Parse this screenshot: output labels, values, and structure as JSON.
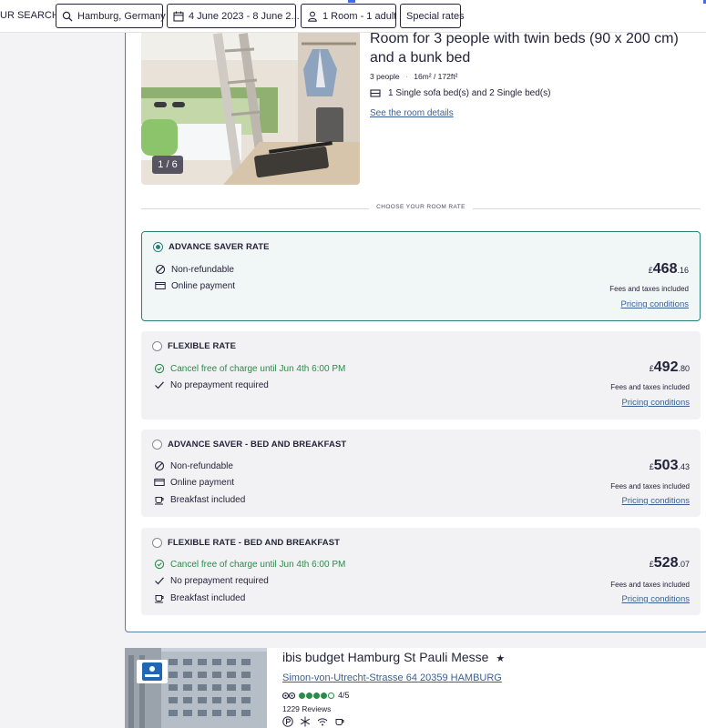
{
  "search": {
    "label": "UR SEARCH",
    "destination": "Hamburg, Germany",
    "dates": "4 June 2023 - 8 June 2...",
    "rooms": "1 Room - 1 adult",
    "special": "Special rates"
  },
  "room": {
    "photo_counter": "1 / 6",
    "title": "Room for 3 people with twin beds (90 x 200 cm) and a bunk bed",
    "people": "3 people",
    "separator": "·",
    "size": "16m² / 172ft²",
    "beds": "1 Single sofa bed(s) and 2 Single bed(s)",
    "details_link": "See the room details"
  },
  "choose_label": "CHOOSE YOUR ROOM RATE",
  "rates": [
    {
      "name": "ADVANCE SAVER RATE",
      "selected": true,
      "features": [
        {
          "icon": "no-entry-icon",
          "text": "Non-refundable",
          "green": false
        },
        {
          "icon": "credit-card-icon",
          "text": "Online payment",
          "green": false
        }
      ],
      "currency": "£",
      "price_int": "468",
      "price_dec": ".16",
      "fees": "Fees and taxes included",
      "conditions": "Pricing conditions"
    },
    {
      "name": "FLEXIBLE RATE",
      "selected": false,
      "features": [
        {
          "icon": "check-circle-icon",
          "text": "Cancel free of charge until Jun 4th 6:00 PM",
          "green": true
        },
        {
          "icon": "checkmark-icon",
          "text": "No prepayment required",
          "green": false
        }
      ],
      "currency": "£",
      "price_int": "492",
      "price_dec": ".80",
      "fees": "Fees and taxes included",
      "conditions": "Pricing conditions"
    },
    {
      "name": "ADVANCE SAVER - BED AND BREAKFAST",
      "selected": false,
      "features": [
        {
          "icon": "no-entry-icon",
          "text": "Non-refundable",
          "green": false
        },
        {
          "icon": "credit-card-icon",
          "text": "Online payment",
          "green": false
        },
        {
          "icon": "coffee-cup-icon",
          "text": "Breakfast included",
          "green": false
        }
      ],
      "currency": "£",
      "price_int": "503",
      "price_dec": ".43",
      "fees": "Fees and taxes included",
      "conditions": "Pricing conditions"
    },
    {
      "name": "FLEXIBLE RATE - BED AND BREAKFAST",
      "selected": false,
      "features": [
        {
          "icon": "check-circle-icon",
          "text": "Cancel free of charge until Jun 4th 6:00 PM",
          "green": true
        },
        {
          "icon": "checkmark-icon",
          "text": "No prepayment required",
          "green": false
        },
        {
          "icon": "coffee-cup-icon",
          "text": "Breakfast included",
          "green": false
        }
      ],
      "currency": "£",
      "price_int": "528",
      "price_dec": ".07",
      "fees": "Fees and taxes included",
      "conditions": "Pricing conditions"
    }
  ],
  "hotel": {
    "name": "ibis budget Hamburg St Pauli Messe",
    "stars": "★",
    "address": "Simon-von-Utrecht-Strasse 64 20359 HAMBURG",
    "rating": "4/5",
    "rating_value": 4,
    "rating_max": 5,
    "reviews": "1229 Reviews",
    "amenities": [
      "parking-icon",
      "snowflake-icon",
      "wifi-icon",
      "coffee-cup-icon"
    ]
  },
  "colors": {
    "accent_teal": "#2c807b",
    "link_blue": "#3b5f95",
    "green_text": "#2c8a4a",
    "text_dark": "#252339"
  }
}
